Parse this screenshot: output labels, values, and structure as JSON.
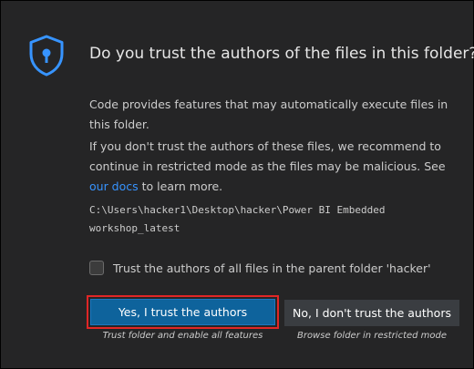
{
  "dialog": {
    "title": "Do you trust the authors of the files in this folder?",
    "paragraph1": "Code provides features that may automatically execute files in this folder.",
    "paragraph2_before_link": "If you don't trust the authors of these files, we recommend to continue in restricted mode as the files may be malicious. See ",
    "paragraph2_link": "our docs",
    "paragraph2_after_link": " to learn more.",
    "folder_path": "C:\\Users\\hacker1\\Desktop\\hacker\\Power BI Embedded workshop_latest",
    "checkbox_label": "Trust the authors of all files in the parent folder 'hacker'",
    "checkbox_checked": false,
    "yes_button_label": "Yes, I trust the authors",
    "yes_button_caption": "Trust folder and enable all features",
    "no_button_label": "No, I don't trust the authors",
    "no_button_caption": "Browse folder in restricted mode",
    "icon": "shield-lock-icon"
  },
  "colors": {
    "background": "#252526",
    "accent_button": "#0e639c",
    "secondary_button": "#3a3d41",
    "link": "#3794ff",
    "shield": "#3794ff",
    "highlight_outline": "#e02626"
  }
}
